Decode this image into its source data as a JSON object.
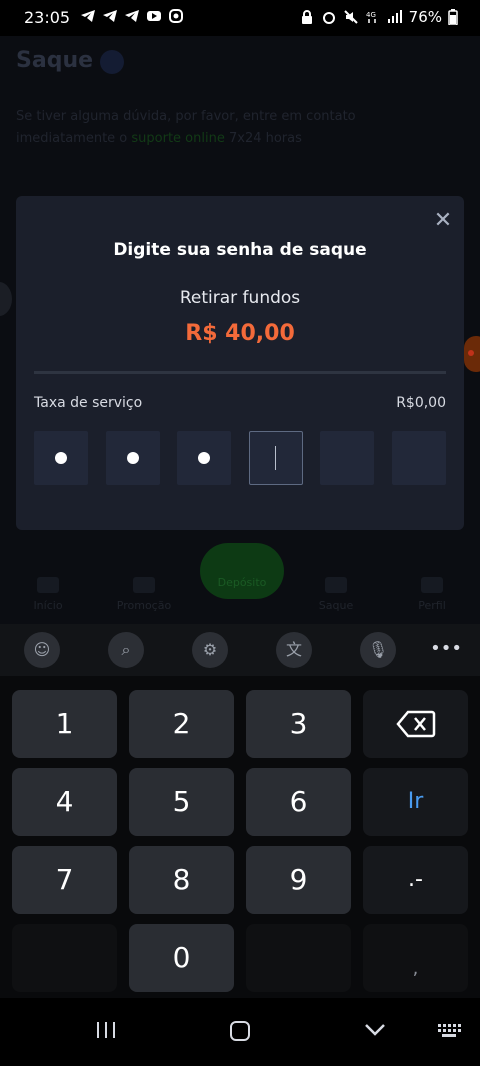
{
  "status_bar": {
    "time": "23:05",
    "battery": "76%",
    "left_icons": [
      "telegram-icon",
      "telegram-icon",
      "telegram-icon",
      "youtube-icon",
      "instagram-icon"
    ],
    "right_icons": [
      "lock-icon",
      "alarm-icon",
      "mute-icon",
      "4g-icon",
      "signal-icon",
      "battery-icon"
    ]
  },
  "background_page": {
    "title": "Saque",
    "notice_line1": "Se tiver alguma dúvida, por favor, entre em contato",
    "notice_line2_prefix": "imediatamente o ",
    "notice_link": "suporte online",
    "notice_line2_suffix": " 7x24 horas"
  },
  "bottom_nav": {
    "items": [
      {
        "label": "Início",
        "icon": "home-icon"
      },
      {
        "label": "Promoção",
        "icon": "gift-icon"
      },
      {
        "label": "Depósito",
        "icon": "deposit-icon"
      },
      {
        "label": "Saque",
        "icon": "wallet-icon"
      },
      {
        "label": "Perfil",
        "icon": "profile-icon"
      }
    ]
  },
  "modal": {
    "title": "Digite sua senha de saque",
    "subtitle": "Retirar fundos",
    "amount": "R$ 40,00",
    "fee_label": "Taxa de serviço",
    "fee_value": "R$0,00",
    "pin_length": 6,
    "pin_filled": 3,
    "accent_color": "#f36a3a"
  },
  "keyboard": {
    "toolbar_icons": [
      "emoji-icon",
      "search-icon",
      "settings-icon",
      "translate-icon",
      "microphone-icon",
      "more-icon"
    ],
    "keys": {
      "k1": "1",
      "k2": "2",
      "k3": "3",
      "k4": "4",
      "k5": "5",
      "k6": "6",
      "k7": "7",
      "k8": "8",
      "k9": "9",
      "k0": "0",
      "go": "Ir",
      "punct": ".-",
      "comma": ","
    }
  },
  "system_nav": {
    "icons": [
      "recents-icon",
      "home-icon",
      "back-icon",
      "keyboard-icon"
    ]
  }
}
